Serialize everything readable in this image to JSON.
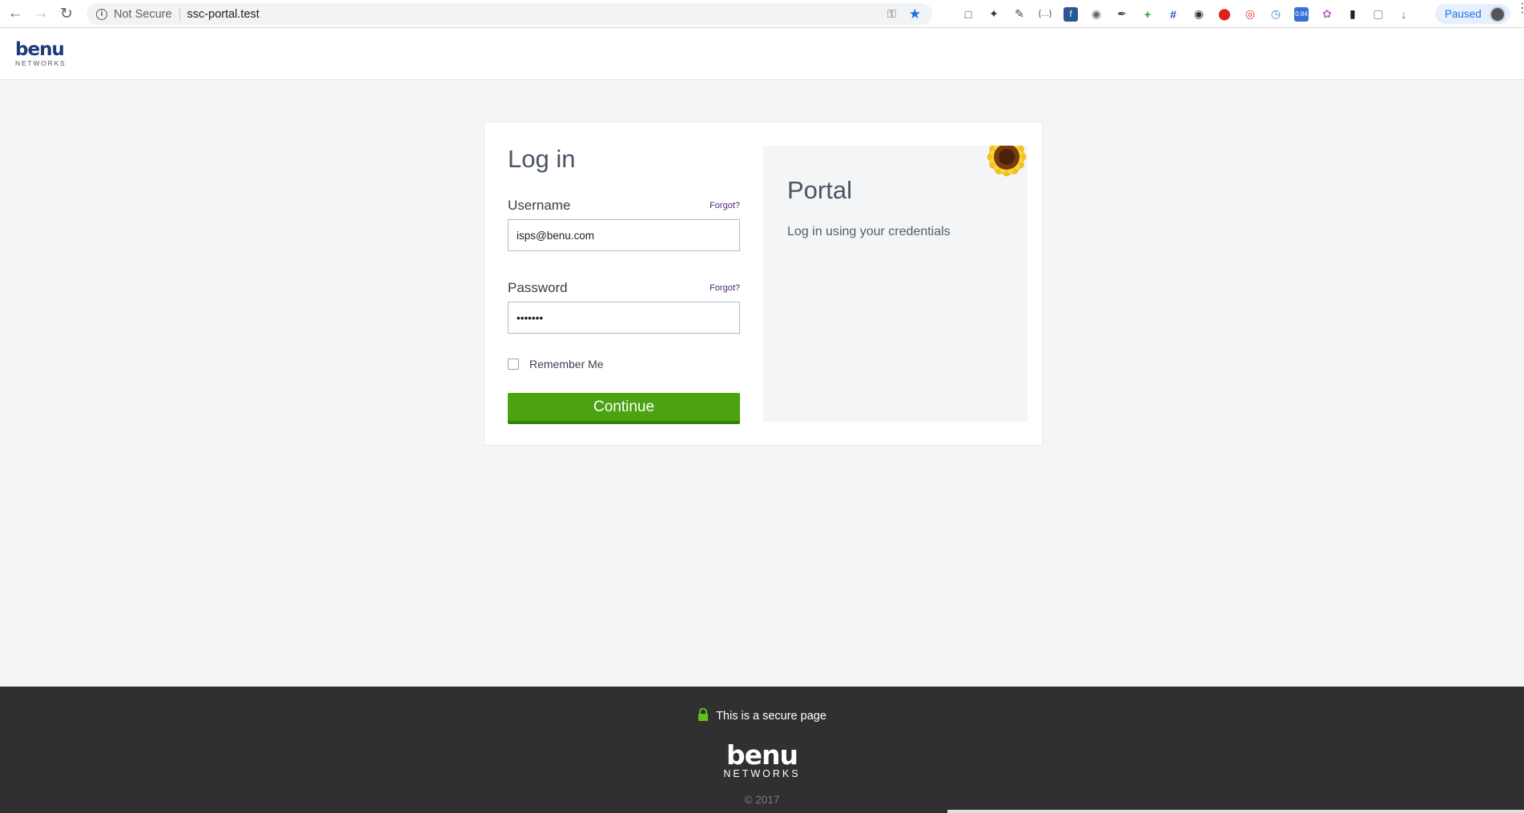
{
  "browser": {
    "security_label": "Not Secure",
    "url": "ssc-portal.test",
    "profile_status": "Paused",
    "extension_badge": "0.84",
    "icons": {
      "back": "arrow-left-icon",
      "forward": "arrow-right-icon",
      "reload": "reload-icon",
      "info": "info-icon",
      "key": "key-icon",
      "bookmark": "star-icon",
      "menu": "more-vert-icon"
    }
  },
  "header": {
    "logo_word": "benu",
    "logo_sub": "NETWORKS"
  },
  "login": {
    "title": "Log in",
    "username_label": "Username",
    "username_forgot": "Forgot?",
    "username_value": "isps@benu.com",
    "password_label": "Password",
    "password_forgot": "Forgot?",
    "password_value": "•••••••",
    "remember_label": "Remember Me",
    "remember_checked": false,
    "continue_label": "Continue"
  },
  "portal": {
    "title": "Portal",
    "subtitle": "Log in using your credentials"
  },
  "footer": {
    "secure_text": "This is a secure page",
    "logo_word": "benu",
    "logo_sub": "NETWORKS",
    "copyright": "© 2017"
  },
  "colors": {
    "accent_green": "#4ca311",
    "brand_blue": "#1f3c7a",
    "footer_bg": "#303030",
    "page_bg": "#f4f5f7"
  }
}
